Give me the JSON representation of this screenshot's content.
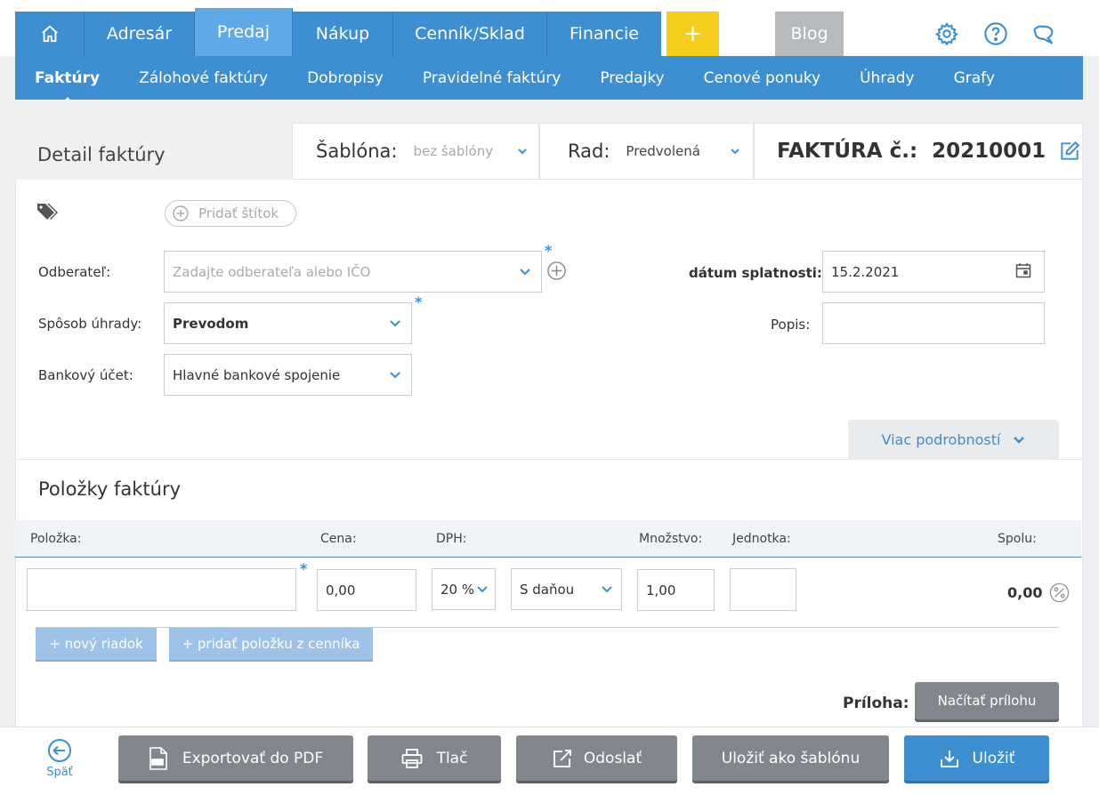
{
  "nav": {
    "items": [
      {
        "label": "Adresár"
      },
      {
        "label": "Predaj"
      },
      {
        "label": "Nákup"
      },
      {
        "label": "Cenník/Sklad"
      },
      {
        "label": "Financie"
      }
    ],
    "plus": "+",
    "blog": "Blog"
  },
  "subnav": {
    "items": [
      {
        "label": "Faktúry"
      },
      {
        "label": "Zálohové faktúry"
      },
      {
        "label": "Dobropisy"
      },
      {
        "label": "Pravidelné faktúry"
      },
      {
        "label": "Predajky"
      },
      {
        "label": "Cenové ponuky"
      },
      {
        "label": "Úhrady"
      },
      {
        "label": "Grafy"
      }
    ]
  },
  "header": {
    "title": "Detail faktúry",
    "template_label": "Šablóna:",
    "template_value": "bez šablóny",
    "series_label": "Rad:",
    "series_value": "Predvolená",
    "invoice_label": "FAKTÚRA č.:",
    "invoice_number": "20210001"
  },
  "form": {
    "tag_button": "Pridať štítok",
    "customer_label": "Odberateľ:",
    "customer_placeholder": "Zadajte odberateľa alebo IČO",
    "payment_label": "Spôsob úhrady:",
    "payment_value": "Prevodom",
    "bank_label": "Bankový účet:",
    "bank_value": "Hlavné bankové spojenie",
    "due_label": "dátum splatnosti:",
    "due_value": "15.2.2021",
    "desc_label": "Popis:",
    "desc_value": "",
    "more_details": "Viac podrobností",
    "required_mark": "*"
  },
  "items": {
    "title": "Položky faktúry",
    "columns": {
      "item": "Položka:",
      "price": "Cena:",
      "vat": "DPH:",
      "qty": "Množstvo:",
      "unit": "Jednotka:",
      "total": "Spolu:"
    },
    "row": {
      "item": "",
      "price": "0,00",
      "vat": "20 %",
      "tax_mode": "S daňou",
      "qty": "1,00",
      "unit": "",
      "total": "0,00"
    },
    "new_row": "+ nový riadok",
    "add_from_catalog": "+ pridať položku z cenníka",
    "attachment_label": "Príloha:",
    "attachment_button": "Načítať prílohu"
  },
  "footer": {
    "back": "Späť",
    "export_pdf": "Exportovať do PDF",
    "print": "Tlač",
    "send": "Odoslať",
    "save_template": "Uložiť ako šablónu",
    "save": "Uložiť"
  },
  "colors": {
    "primary": "#3d8fd1",
    "active_tab": "#5ea9e6",
    "accent_yellow": "#f7cd1d",
    "gray_button": "#82878d"
  }
}
